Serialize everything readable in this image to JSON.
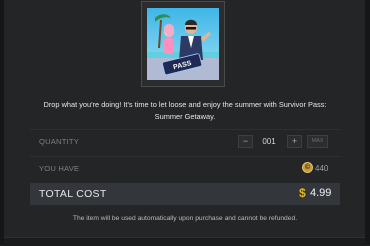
{
  "item": {
    "thumbnail_icon": "survivor-pass-art",
    "thumbnail_badge": "PASS",
    "description": "Drop what you're doing! It's time to let loose and enjoy the summer with Survivor Pass: Summer Getaway."
  },
  "quantity": {
    "label": "QUANTITY",
    "minus_label": "−",
    "value": "001",
    "plus_label": "+",
    "max_label": "MAX"
  },
  "balance": {
    "label": "YOU HAVE",
    "currency_icon": "coin-icon",
    "currency_symbol": "©",
    "amount": "440"
  },
  "total": {
    "label": "TOTAL COST",
    "currency_symbol": "$",
    "amount": "4.99"
  },
  "notice": "The item will be used automatically upon purchase and cannot be refunded.",
  "colors": {
    "accent": "#e4b320",
    "background": "#232527"
  }
}
